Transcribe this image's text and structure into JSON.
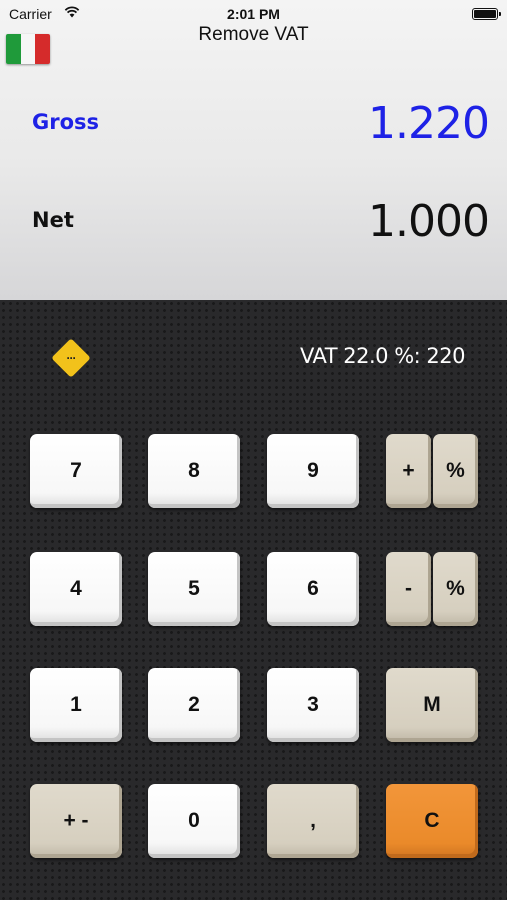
{
  "status_bar": {
    "carrier": "Carrier",
    "time": "2:01 PM"
  },
  "header": {
    "title": "Remove VAT",
    "flag_icon": "italy-flag-icon"
  },
  "display": {
    "gross_label": "Gross",
    "gross_value": "1.220",
    "net_label": "Net",
    "net_value": "1.000",
    "accent_color": "#1e22e6"
  },
  "info": {
    "menu_icon": "more-diamond-icon",
    "menu_glyph": "···",
    "vat_text": "VAT 22.0 %: 220"
  },
  "keypad": {
    "keys": {
      "k7": "7",
      "k8": "8",
      "k9": "9",
      "k4": "4",
      "k5": "5",
      "k6": "6",
      "k1": "1",
      "k2": "2",
      "k3": "3",
      "plusminus": "+ -",
      "k0": "0",
      "comma": ",",
      "add": "+",
      "add_percent": "%",
      "sub": "-",
      "sub_percent": "%",
      "memory": "M",
      "clear": "C"
    },
    "colors": {
      "digit": "#ffffff",
      "function": "#d6cfbf",
      "clear": "#ea8a2a"
    }
  }
}
